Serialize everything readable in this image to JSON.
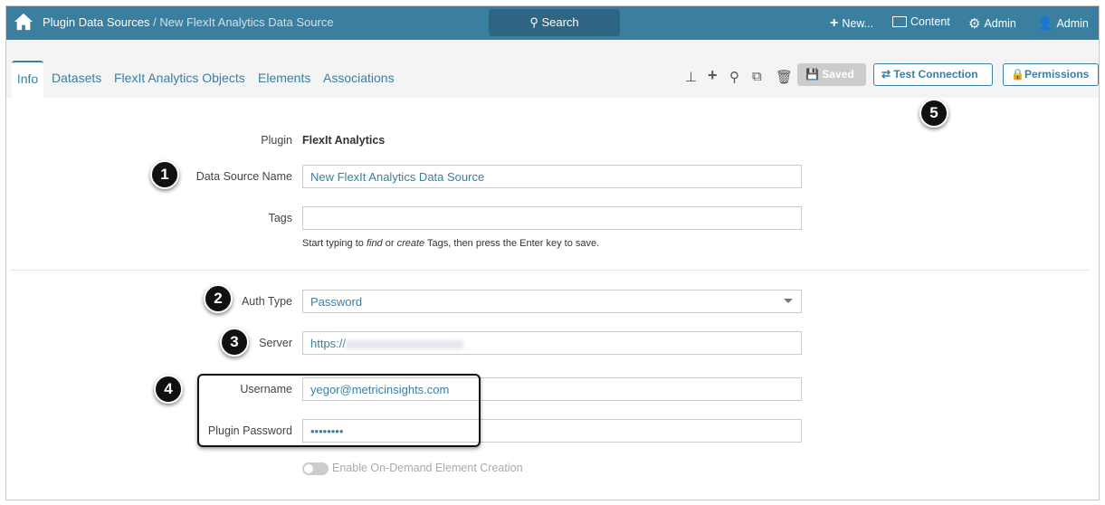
{
  "header": {
    "breadcrumb_root": "Plugin Data Sources",
    "breadcrumb_sep": " / ",
    "breadcrumb_current": "New FlexIt Analytics Data Source",
    "search_label": "Search",
    "new_label": "New...",
    "content_label": "Content",
    "admin_label": "Admin",
    "user_label": "Admin"
  },
  "tabs": [
    "Info",
    "Datasets",
    "FlexIt Analytics Objects",
    "Elements",
    "Associations"
  ],
  "toolbar": {
    "saved_label": "Saved",
    "test_label": "Test Connection",
    "permissions_label": "Permissions"
  },
  "form": {
    "plugin_label": "Plugin",
    "plugin_value": "FlexIt Analytics",
    "name_label": "Data Source Name",
    "name_value": "New FlexIt Analytics Data Source",
    "tags_label": "Tags",
    "tags_value": "",
    "tags_help_1": "Start typing to ",
    "tags_help_find": "find",
    "tags_help_2": " or ",
    "tags_help_create": "create",
    "tags_help_3": " Tags, then press the Enter key to save.",
    "auth_label": "Auth Type",
    "auth_value": "Password",
    "server_label": "Server",
    "server_value": "https://",
    "username_label": "Username",
    "username_value": "yegor@metricinsights.com",
    "password_label": "Plugin Password",
    "password_value": "••••••••",
    "toggle_label": "Enable On-Demand Element Creation"
  },
  "markers": [
    "1",
    "2",
    "3",
    "4",
    "5"
  ]
}
